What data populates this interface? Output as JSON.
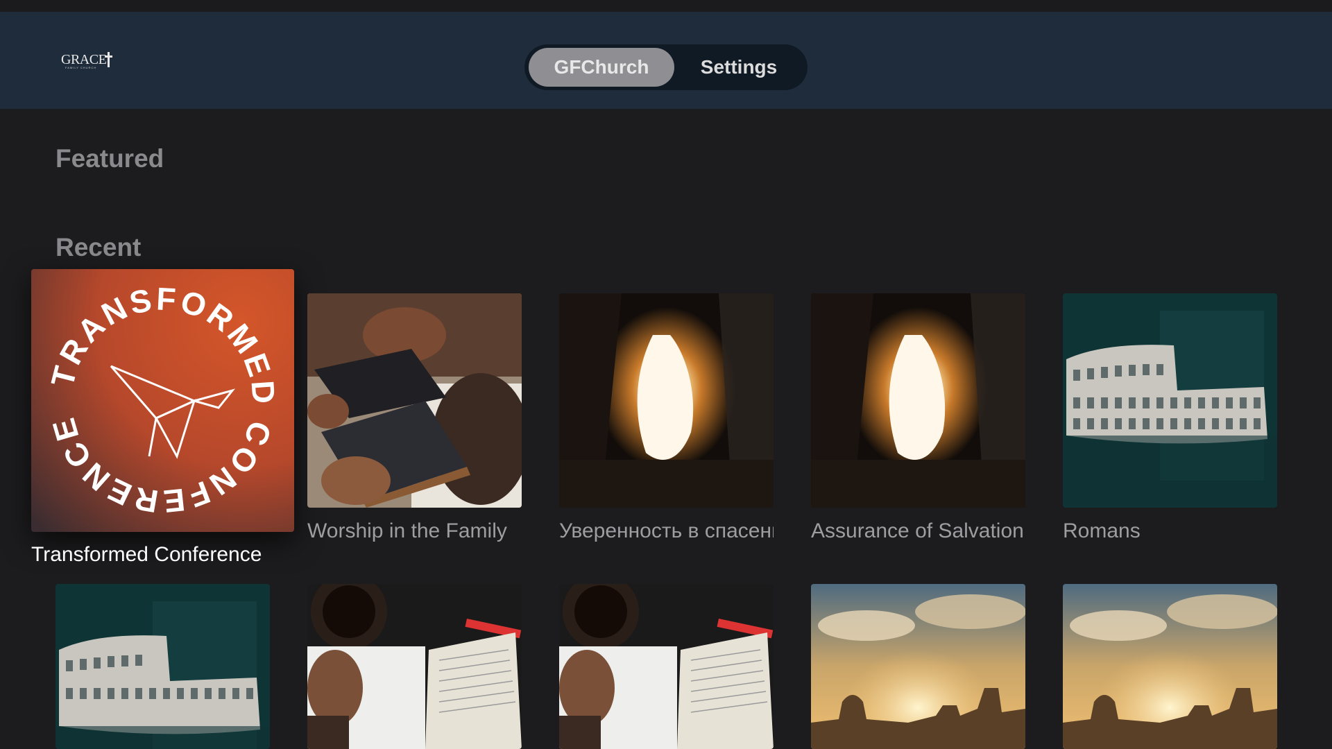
{
  "app": {
    "logo_text": "GRACE",
    "logo_subtext": "FAMILY CHURCH",
    "tabs": [
      {
        "label": "GFChurch",
        "active": true
      },
      {
        "label": "Settings",
        "active": false
      }
    ]
  },
  "sections": {
    "featured_title": "Featured",
    "recent_title": "Recent"
  },
  "recent_row1": [
    {
      "title": "Transformed Conference",
      "art": "transformed-conference-art",
      "focused": true
    },
    {
      "title": "Worship in the Family",
      "art": "hands-on-bibles-art"
    },
    {
      "title": "Уверенность в спасении",
      "art": "empty-tomb-art"
    },
    {
      "title": "Assurance of Salvation",
      "art": "empty-tomb-art"
    },
    {
      "title": "Romans",
      "art": "colosseum-art"
    }
  ],
  "recent_row2": [
    {
      "art": "colosseum-art"
    },
    {
      "art": "bible-journal-art"
    },
    {
      "art": "bible-journal-art"
    },
    {
      "art": "sunrise-city-art"
    },
    {
      "art": "sunrise-city-art"
    }
  ],
  "colors": {
    "header_bg": "#1f2c3b",
    "page_bg": "#1c1c1e",
    "tab_active_bg": "#8e8e93",
    "conference_orange": "#c8552b"
  }
}
